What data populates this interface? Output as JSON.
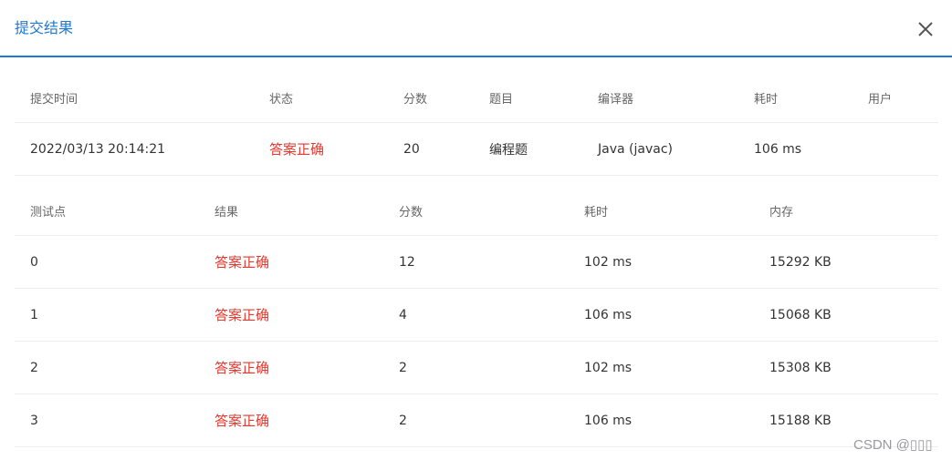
{
  "dialog": {
    "title": "提交结果"
  },
  "summary": {
    "headers": [
      "提交时间",
      "状态",
      "分数",
      "题目",
      "编译器",
      "耗时",
      "用户"
    ],
    "row": {
      "time": "2022/03/13 20:14:21",
      "status": "答案正确",
      "score": "20",
      "problem": "编程题",
      "compiler": "Java (javac)",
      "elapsed": "106 ms",
      "user": ""
    }
  },
  "testcases": {
    "headers": [
      "测试点",
      "结果",
      "分数",
      "耗时",
      "内存"
    ],
    "rows": [
      {
        "id": "0",
        "result": "答案正确",
        "score": "12",
        "time": "102 ms",
        "memory": "15292 KB"
      },
      {
        "id": "1",
        "result": "答案正确",
        "score": "4",
        "time": "106 ms",
        "memory": "15068 KB"
      },
      {
        "id": "2",
        "result": "答案正确",
        "score": "2",
        "time": "102 ms",
        "memory": "15308 KB"
      },
      {
        "id": "3",
        "result": "答案正确",
        "score": "2",
        "time": "106 ms",
        "memory": "15188 KB"
      }
    ]
  },
  "watermark": "CSDN @▯▯▯",
  "colors": {
    "accent": "#1f78d1",
    "success_text": "#e5382f"
  },
  "icons": {
    "close": "close-icon"
  }
}
